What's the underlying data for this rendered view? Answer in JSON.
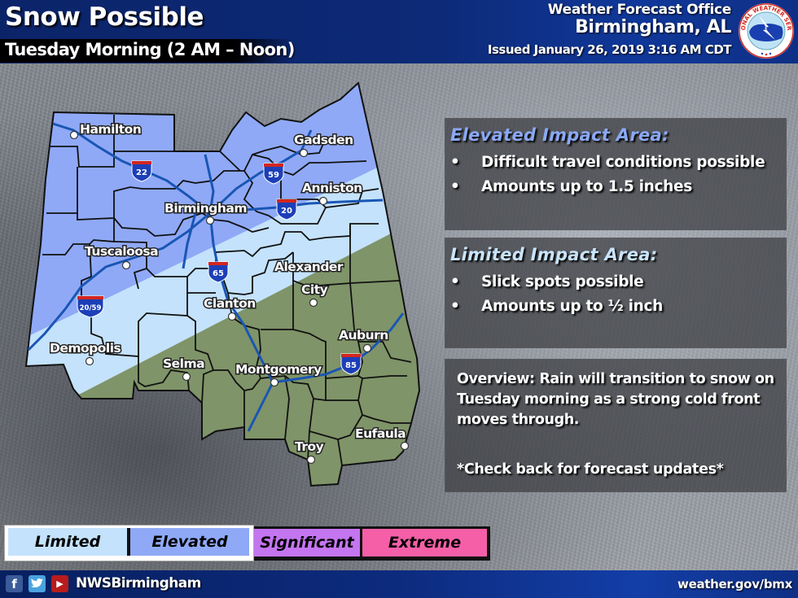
{
  "header": {
    "title": "Snow Possible",
    "subtitle": "Tuesday Morning (2 AM – Noon)",
    "office_line1": "Weather Forecast Office",
    "office_line2": "Birmingham, AL",
    "issued": "Issued January 26, 2019 3:16 AM CDT",
    "logo": "nws-logo-icon"
  },
  "map": {
    "colors": {
      "limited": "#c4e2fc",
      "elevated": "#8fa9f7",
      "no_impact": "#7f9468",
      "county_border": "#111111",
      "interstate": "#1a56b4"
    },
    "cities": [
      {
        "name": "Hamilton"
      },
      {
        "name": "Gadsden"
      },
      {
        "name": "Birmingham"
      },
      {
        "name": "Anniston"
      },
      {
        "name": "Tuscaloosa"
      },
      {
        "name": "Alexander"
      },
      {
        "name": "City"
      },
      {
        "name": "Clanton"
      },
      {
        "name": "Demopolis"
      },
      {
        "name": "Selma"
      },
      {
        "name": "Montgomery"
      },
      {
        "name": "Auburn"
      },
      {
        "name": "Troy"
      },
      {
        "name": "Eufaula"
      }
    ],
    "interstates": [
      {
        "label": "22"
      },
      {
        "label": "59"
      },
      {
        "label": "20"
      },
      {
        "label": "65"
      },
      {
        "label": "20/59"
      },
      {
        "label": "85"
      }
    ]
  },
  "panels": {
    "elevated": {
      "heading": "Elevated Impact Area:",
      "bullets": [
        "Difficult travel conditions possible",
        "Amounts up to 1.5 inches"
      ]
    },
    "limited": {
      "heading": "Limited Impact Area:",
      "bullets": [
        "Slick spots possible",
        "Amounts up to ½ inch"
      ]
    },
    "overview": {
      "text": "Overview: Rain will transition to snow on Tuesday morning as a strong cold front moves through.",
      "check": "*Check back for forecast updates*"
    },
    "bullet_glyph": "•"
  },
  "legend": {
    "items": [
      {
        "label": "Limited",
        "color": "#c4e2fc",
        "active": true
      },
      {
        "label": "Elevated",
        "color": "#8fa9f7",
        "active": true
      },
      {
        "label": "Significant",
        "color": "#c475f0",
        "active": false
      },
      {
        "label": "Extreme",
        "color": "#f55fa8",
        "active": false
      }
    ]
  },
  "footer": {
    "social_icons": [
      "facebook-icon",
      "twitter-icon",
      "youtube-icon"
    ],
    "handle": "NWSBirmingham",
    "website": "weather.gov/bmx"
  }
}
